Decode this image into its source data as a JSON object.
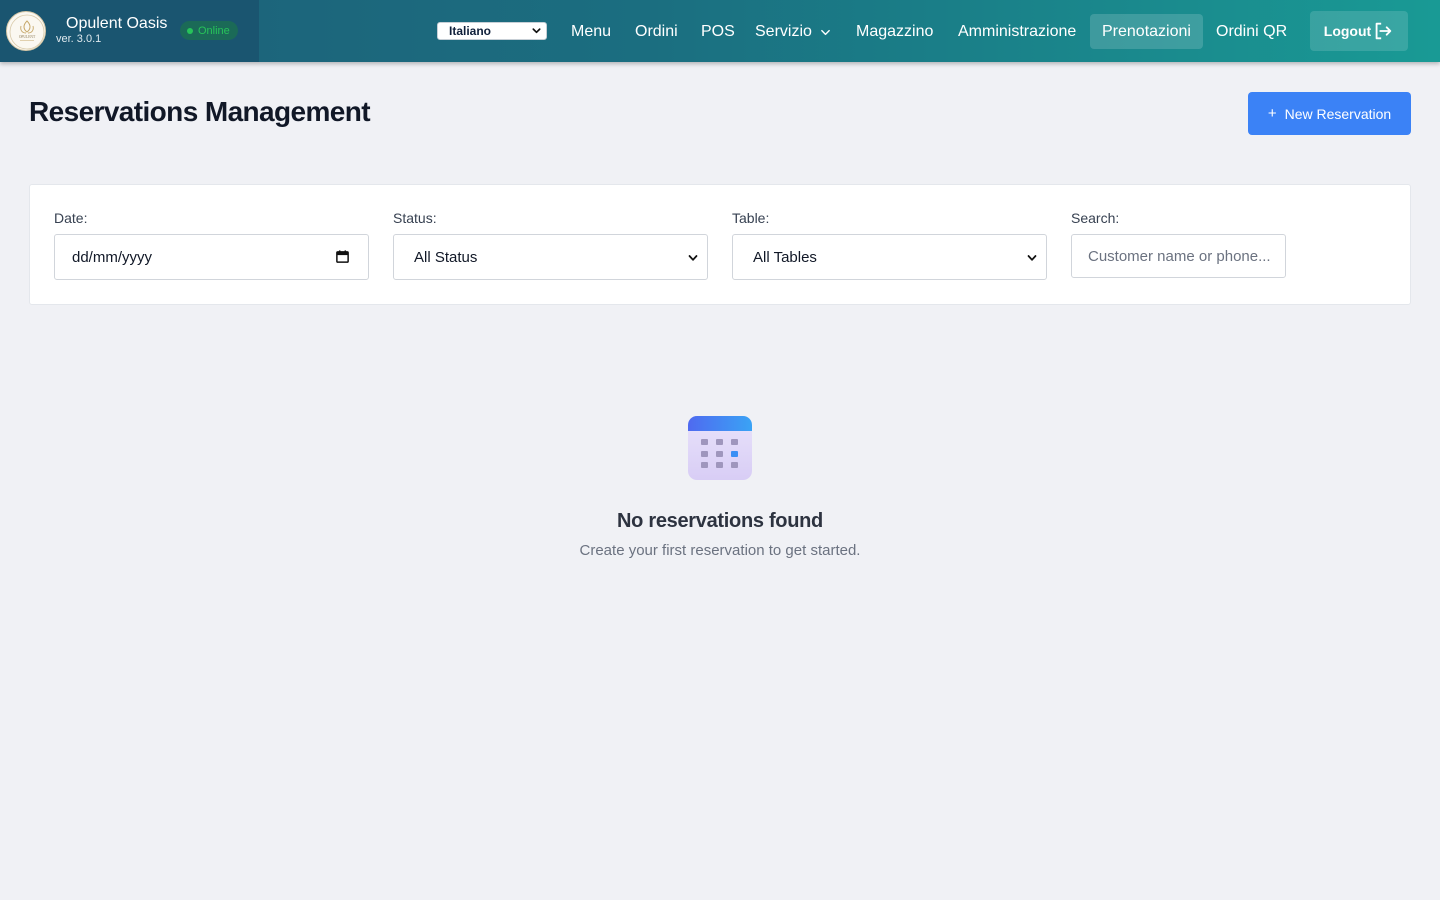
{
  "app": {
    "name": "Opulent Oasis",
    "version": "ver. 3.0.1",
    "status": "Online",
    "logo_text": "OPULENT",
    "colors": {
      "nav_gradient_start": "#1d5f78",
      "nav_gradient_end": "#199a95",
      "status_green": "#27c35a",
      "primary_button": "#3b82f6"
    }
  },
  "language": {
    "selected": "Italiano",
    "icon": "chevron-down-icon"
  },
  "nav": {
    "items": [
      {
        "label": "Menu"
      },
      {
        "label": "Ordini"
      },
      {
        "label": "POS"
      },
      {
        "label": "Servizio",
        "has_dropdown": true
      },
      {
        "label": "Magazzino"
      },
      {
        "label": "Amministrazione"
      },
      {
        "label": "Prenotazioni",
        "active": true
      },
      {
        "label": "Ordini QR"
      }
    ],
    "logout_label": "Logout",
    "logout_icon": "logout-icon"
  },
  "page": {
    "title": "Reservations Management",
    "new_button_label": "New Reservation",
    "new_button_icon": "plus-icon"
  },
  "filters": {
    "date": {
      "label": "Date:",
      "value": "dd/mm/yyyy",
      "icon": "calendar-icon"
    },
    "status": {
      "label": "Status:",
      "value": "All Status"
    },
    "table": {
      "label": "Table:",
      "value": "All Tables"
    },
    "search": {
      "label": "Search:",
      "placeholder": "Customer name or phone..."
    }
  },
  "empty_state": {
    "icon": "calendar-icon",
    "title": "No reservations found",
    "subtitle": "Create your first reservation to get started."
  }
}
